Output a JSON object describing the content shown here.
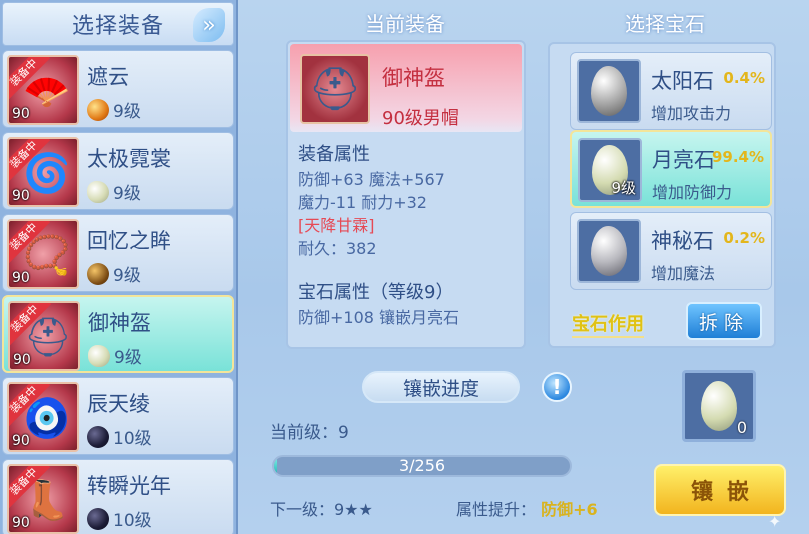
{
  "left": {
    "title": "选择装备",
    "items": [
      {
        "name": "遮云",
        "badge": "装备中",
        "level": "90",
        "gem_level": "9级",
        "icon": "fan-icon",
        "gem": "orange"
      },
      {
        "name": "太极霓裳",
        "badge": "装备中",
        "level": "90",
        "gem_level": "9级",
        "icon": "robe-icon",
        "gem": "pale"
      },
      {
        "name": "回忆之眸",
        "badge": "装备中",
        "level": "90",
        "gem_level": "9级",
        "icon": "necklace-icon",
        "gem": "brown"
      },
      {
        "name": "御神盔",
        "badge": "装备中",
        "level": "90",
        "gem_level": "9级",
        "icon": "helmet-icon",
        "gem": "pale"
      },
      {
        "name": "辰天绫",
        "badge": "装备中",
        "level": "90",
        "gem_level": "10级",
        "icon": "belt-icon",
        "gem": "dark"
      },
      {
        "name": "转瞬光年",
        "badge": "装备中",
        "level": "90",
        "gem_level": "10级",
        "icon": "boots-icon",
        "gem": "dark"
      }
    ]
  },
  "current": {
    "title": "当前装备",
    "name": "御神盔",
    "subtitle": "90级男帽",
    "attr_title": "装备属性",
    "attr_line1": "防御+63 魔法+567",
    "attr_line2": "魔力-11 耐力+32",
    "special": "[天降甘霖]",
    "durability": "耐久：382",
    "gem_attr_title": "宝石属性（等级9）",
    "gem_attr_line": "防御+108 镶嵌月亮石"
  },
  "progress": {
    "label": "镶嵌进度",
    "current_level": "当前级：9",
    "text": "3/256",
    "fraction": 0.0117,
    "next_level": "下一级：9★★",
    "attr_up_label": "属性提升：",
    "attr_up_value": "防御+6"
  },
  "gems": {
    "title": "选择宝石",
    "options": [
      {
        "name": "太阳石",
        "pct": "0.4%",
        "effect": "增加攻击力",
        "count": ""
      },
      {
        "name": "月亮石",
        "pct": "99.4%",
        "effect": "增加防御力",
        "count": "9级"
      },
      {
        "name": "神秘石",
        "pct": "0.2%",
        "effect": "增加魔法",
        "count": ""
      }
    ],
    "effect_label": "宝石作用",
    "remove_label": "拆除",
    "selected_count": "0",
    "inlay_label": "镶嵌"
  },
  "colors": {
    "accent": "#3a5a93",
    "highlight": "#79e2d8",
    "gold": "#e3b61c",
    "red": "#c42f40"
  }
}
